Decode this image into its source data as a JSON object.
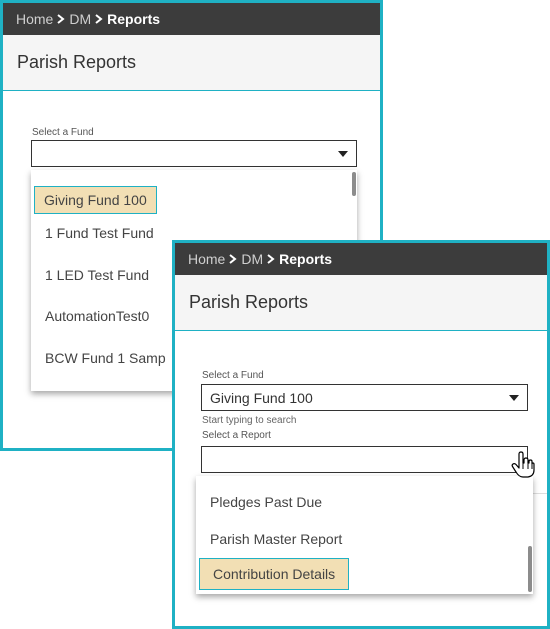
{
  "panel1": {
    "breadcrumb": [
      {
        "label": "Home"
      },
      {
        "label": "DM"
      },
      {
        "label": "Reports",
        "current": true
      }
    ],
    "page_title": "Parish Reports",
    "fund_label": "Select a Fund",
    "fund_value": "",
    "fund_options": [
      "Giving Fund 100",
      "1 Fund Test Fund",
      "1 LED Test Fund",
      "AutomationTest0",
      "BCW Fund 1 Samp"
    ],
    "highlighted_option": "Giving Fund 100"
  },
  "panel2": {
    "breadcrumb": [
      {
        "label": "Home"
      },
      {
        "label": "DM"
      },
      {
        "label": "Reports",
        "current": true
      }
    ],
    "page_title": "Parish Reports",
    "fund_label": "Select a Fund",
    "fund_value": "Giving Fund 100",
    "search_hint": "Start typing to search",
    "report_label": "Select a Report",
    "report_value": "",
    "report_options": [
      "Pledges Past Due",
      "Parish Master Report",
      "Contribution Details"
    ],
    "highlighted_option": "Contribution Details"
  },
  "colors": {
    "accent": "#1fb1c4",
    "breadcrumb_bg": "#3c3c3c",
    "highlight": "#f2dfb4"
  },
  "icons": [
    "chevron-right-icon",
    "dropdown-caret-icon",
    "hand-pointer-icon"
  ]
}
